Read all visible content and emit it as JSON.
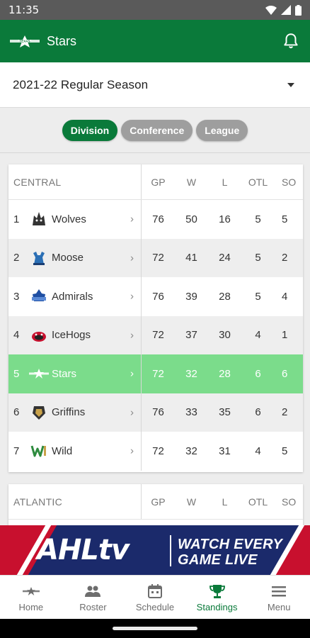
{
  "status": {
    "time": "11:35"
  },
  "appbar": {
    "title": "Stars"
  },
  "season": {
    "selected": "2021-22 Regular Season"
  },
  "segments": [
    {
      "label": "Division",
      "active": true
    },
    {
      "label": "Conference",
      "active": false
    },
    {
      "label": "League",
      "active": false
    }
  ],
  "columns": [
    "GP",
    "W",
    "L",
    "OTL",
    "SO"
  ],
  "divisions": [
    {
      "name": "CENTRAL",
      "teams": [
        {
          "rank": "1",
          "name": "Wolves",
          "gp": "76",
          "w": "50",
          "l": "16",
          "otl": "5",
          "so": "5"
        },
        {
          "rank": "2",
          "name": "Moose",
          "gp": "72",
          "w": "41",
          "l": "24",
          "otl": "5",
          "so": "2"
        },
        {
          "rank": "3",
          "name": "Admirals",
          "gp": "76",
          "w": "39",
          "l": "28",
          "otl": "5",
          "so": "4"
        },
        {
          "rank": "4",
          "name": "IceHogs",
          "gp": "72",
          "w": "37",
          "l": "30",
          "otl": "4",
          "so": "1"
        },
        {
          "rank": "5",
          "name": "Stars",
          "gp": "72",
          "w": "32",
          "l": "28",
          "otl": "6",
          "so": "6"
        },
        {
          "rank": "6",
          "name": "Griffins",
          "gp": "76",
          "w": "33",
          "l": "35",
          "otl": "6",
          "so": "2"
        },
        {
          "rank": "7",
          "name": "Wild",
          "gp": "72",
          "w": "32",
          "l": "31",
          "otl": "4",
          "so": "5"
        }
      ]
    },
    {
      "name": "ATLANTIC",
      "teams": []
    }
  ],
  "ad": {
    "brand": "AHLtv",
    "line1": "WATCH EVERY",
    "line2": "GAME LIVE"
  },
  "nav": [
    {
      "label": "Home",
      "icon": "stars-logo-icon"
    },
    {
      "label": "Roster",
      "icon": "people-icon"
    },
    {
      "label": "Schedule",
      "icon": "calendar-icon"
    },
    {
      "label": "Standings",
      "icon": "trophy-icon",
      "active": true
    },
    {
      "label": "Menu",
      "icon": "hamburger-icon"
    }
  ],
  "colors": {
    "primary": "#0a7a3a",
    "highlight": "#7bdc8b",
    "inactive_pill": "#9e9e9e"
  }
}
